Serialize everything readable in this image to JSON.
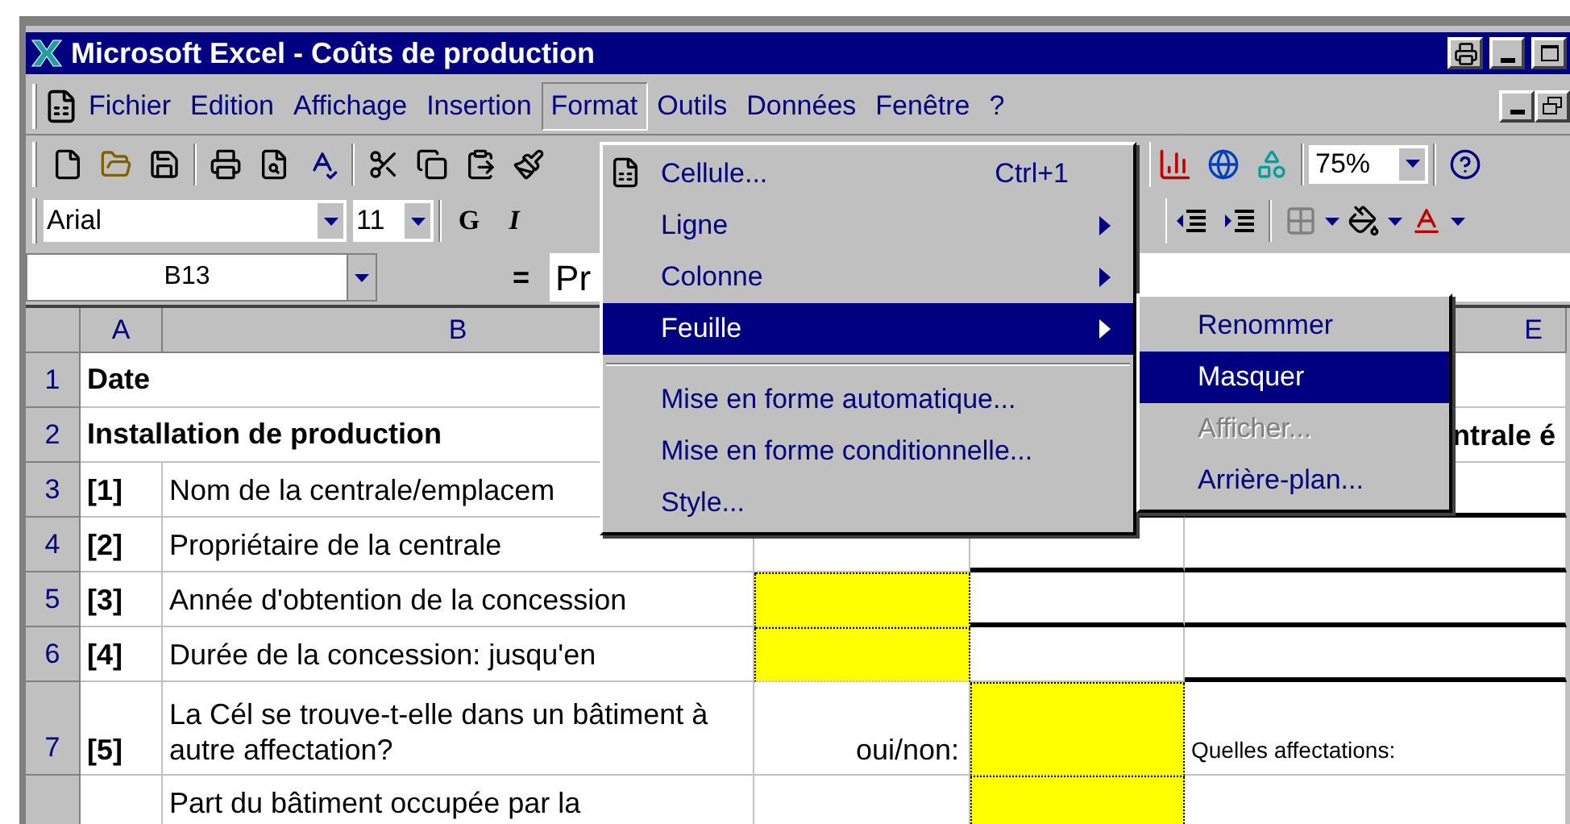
{
  "window": {
    "title": "Microsoft Excel - Coûts de production"
  },
  "menu_bar": [
    {
      "label": "Fichier",
      "selected": false
    },
    {
      "label": "Edition",
      "selected": false
    },
    {
      "label": "Affichage",
      "selected": false
    },
    {
      "label": "Insertion",
      "selected": false
    },
    {
      "label": "Format",
      "selected": true
    },
    {
      "label": "Outils",
      "selected": false
    },
    {
      "label": "Données",
      "selected": false
    },
    {
      "label": "Fenêtre",
      "selected": false
    },
    {
      "label": "?",
      "selected": false
    }
  ],
  "standard_toolbar": {
    "zoom": "75%"
  },
  "formatting_toolbar": {
    "font": "Arial",
    "size": "11",
    "bold": "G",
    "italic": "I"
  },
  "formula_bar": {
    "name_box": "B13",
    "equals": "=",
    "value": "Pr"
  },
  "columns": [
    {
      "label": "A"
    },
    {
      "label": "B"
    },
    {},
    {},
    {
      "label": "E"
    }
  ],
  "rows": [
    {
      "number": "1",
      "kind": "heading",
      "cells": [
        {
          "text": "Date",
          "bold": true
        },
        {},
        {},
        {},
        {}
      ]
    },
    {
      "number": "2",
      "kind": "heading",
      "cells": [
        {
          "text": "Installation de production",
          "bold": true
        },
        {},
        {},
        {},
        {
          "text": "ntrale é",
          "bold": true,
          "align_right": true
        }
      ]
    },
    {
      "number": "3",
      "kind": "item",
      "cells": [
        {
          "text": "[1]",
          "bold": true
        },
        {
          "text": "Nom de la centrale/emplacem"
        },
        {},
        {
          "border_bottom": true
        },
        {
          "border_bottom": true
        }
      ]
    },
    {
      "number": "4",
      "kind": "item",
      "cells": [
        {
          "text": "[2]",
          "bold": true
        },
        {
          "text": "Propriétaire de la centrale"
        },
        {},
        {
          "border_bottom": true
        },
        {
          "border_bottom": true
        }
      ]
    },
    {
      "number": "5",
      "kind": "item",
      "cells": [
        {
          "text": "[3]",
          "bold": true
        },
        {
          "text": "Année d'obtention de la concession"
        },
        {
          "highlight": true
        },
        {
          "border_bottom": true
        },
        {
          "border_bottom": true
        }
      ]
    },
    {
      "number": "6",
      "kind": "item",
      "cells": [
        {
          "text": "[4]",
          "bold": true
        },
        {
          "text": "Durée de la concession: jusqu'en"
        },
        {
          "highlight": true
        },
        {},
        {
          "border_bottom": true
        }
      ]
    },
    {
      "number": "7",
      "kind": "tall",
      "cells": [
        {
          "text": "[5]",
          "bold": true
        },
        {
          "text": "La Cél se trouve-t-elle dans un bâtiment à autre affectation?"
        },
        {
          "text": "oui/non:",
          "align_right": true
        },
        {
          "highlight": true
        },
        {
          "text": "Quelles affectations:",
          "small": true
        }
      ]
    },
    {
      "kind": "item",
      "cells": [
        {},
        {
          "text": "Part du bâtiment occupée par la"
        },
        {},
        {
          "highlight": true
        },
        {}
      ]
    }
  ],
  "format_menu": [
    {
      "kind": "item",
      "label": "Cellule...",
      "shortcut": "Ctrl+1",
      "selected": false
    },
    {
      "kind": "item",
      "label": "Ligne",
      "has_submenu": true,
      "selected": false
    },
    {
      "kind": "item",
      "label": "Colonne",
      "has_submenu": true,
      "selected": false
    },
    {
      "kind": "item",
      "label": "Feuille",
      "has_submenu": true,
      "selected": true,
      "submenu": [
        {
          "label": "Renommer",
          "selected": false,
          "disabled": false
        },
        {
          "label": "Masquer",
          "selected": true,
          "disabled": false
        },
        {
          "label": "Afficher...",
          "selected": false,
          "disabled": true
        },
        {
          "label": "Arrière-plan...",
          "selected": false,
          "disabled": false
        }
      ]
    },
    {
      "kind": "separator"
    },
    {
      "kind": "item",
      "label": "Mise en forme automatique...",
      "selected": false
    },
    {
      "kind": "item",
      "label": "Mise en forme conditionnelle...",
      "selected": false
    },
    {
      "kind": "item",
      "label": "Style...",
      "selected": false
    }
  ]
}
